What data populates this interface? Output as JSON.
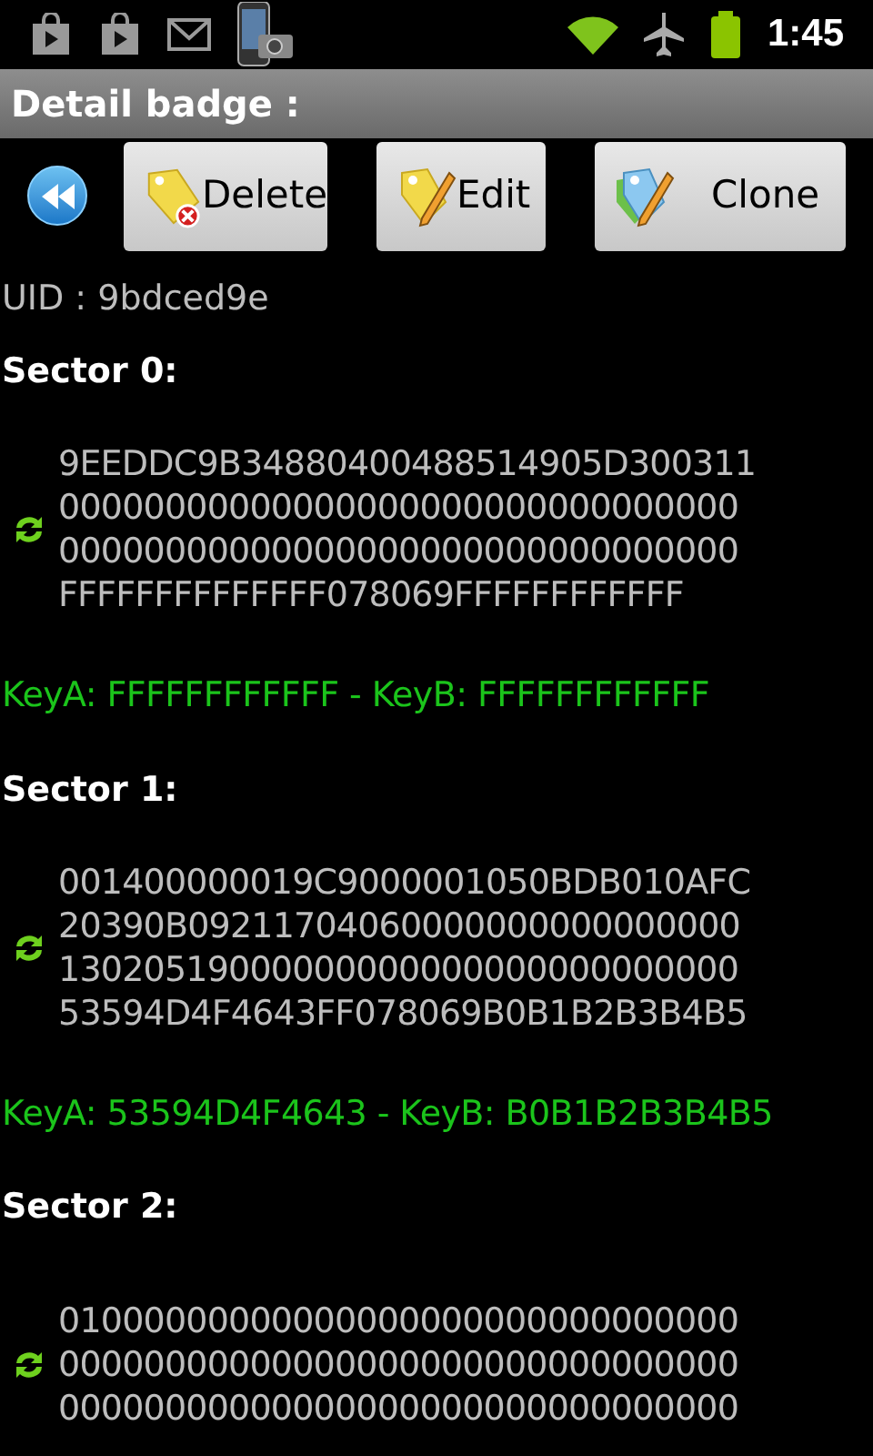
{
  "status_bar": {
    "time": "1:45"
  },
  "title": "Detail badge :",
  "buttons": [
    {
      "kind": "back"
    },
    {
      "kind": "delete",
      "label": "Delete"
    },
    {
      "kind": "edit",
      "label": "Edit"
    },
    {
      "kind": "clone",
      "label": "Clone"
    }
  ],
  "uid": "UID : 9bdced9e",
  "sectors": [
    {
      "title": "Sector 0:",
      "blocks": [
        "9EEDDC9B34880400488514905D300311",
        "00000000000000000000000000000000",
        "00000000000000000000000000000000",
        "FFFFFFFFFFFFFF078069FFFFFFFFFFFF"
      ],
      "keys": "KeyA: FFFFFFFFFFFF - KeyB: FFFFFFFFFFFF"
    },
    {
      "title": "Sector 1:",
      "blocks": [
        "001400000019C9000001050BDB010AFC",
        "20390B09211704060000000000000000",
        "13020519000000000000000000000000",
        "53594D4F4643FF078069B0B1B2B3B4B5"
      ],
      "keys": "KeyA: 53594D4F4643 - KeyB: B0B1B2B3B4B5"
    },
    {
      "title": "Sector 2:",
      "blocks": [
        "01000000000000000000000000000000",
        "00000000000000000000000000000000",
        "00000000000000000000000000000000"
      ]
    }
  ]
}
